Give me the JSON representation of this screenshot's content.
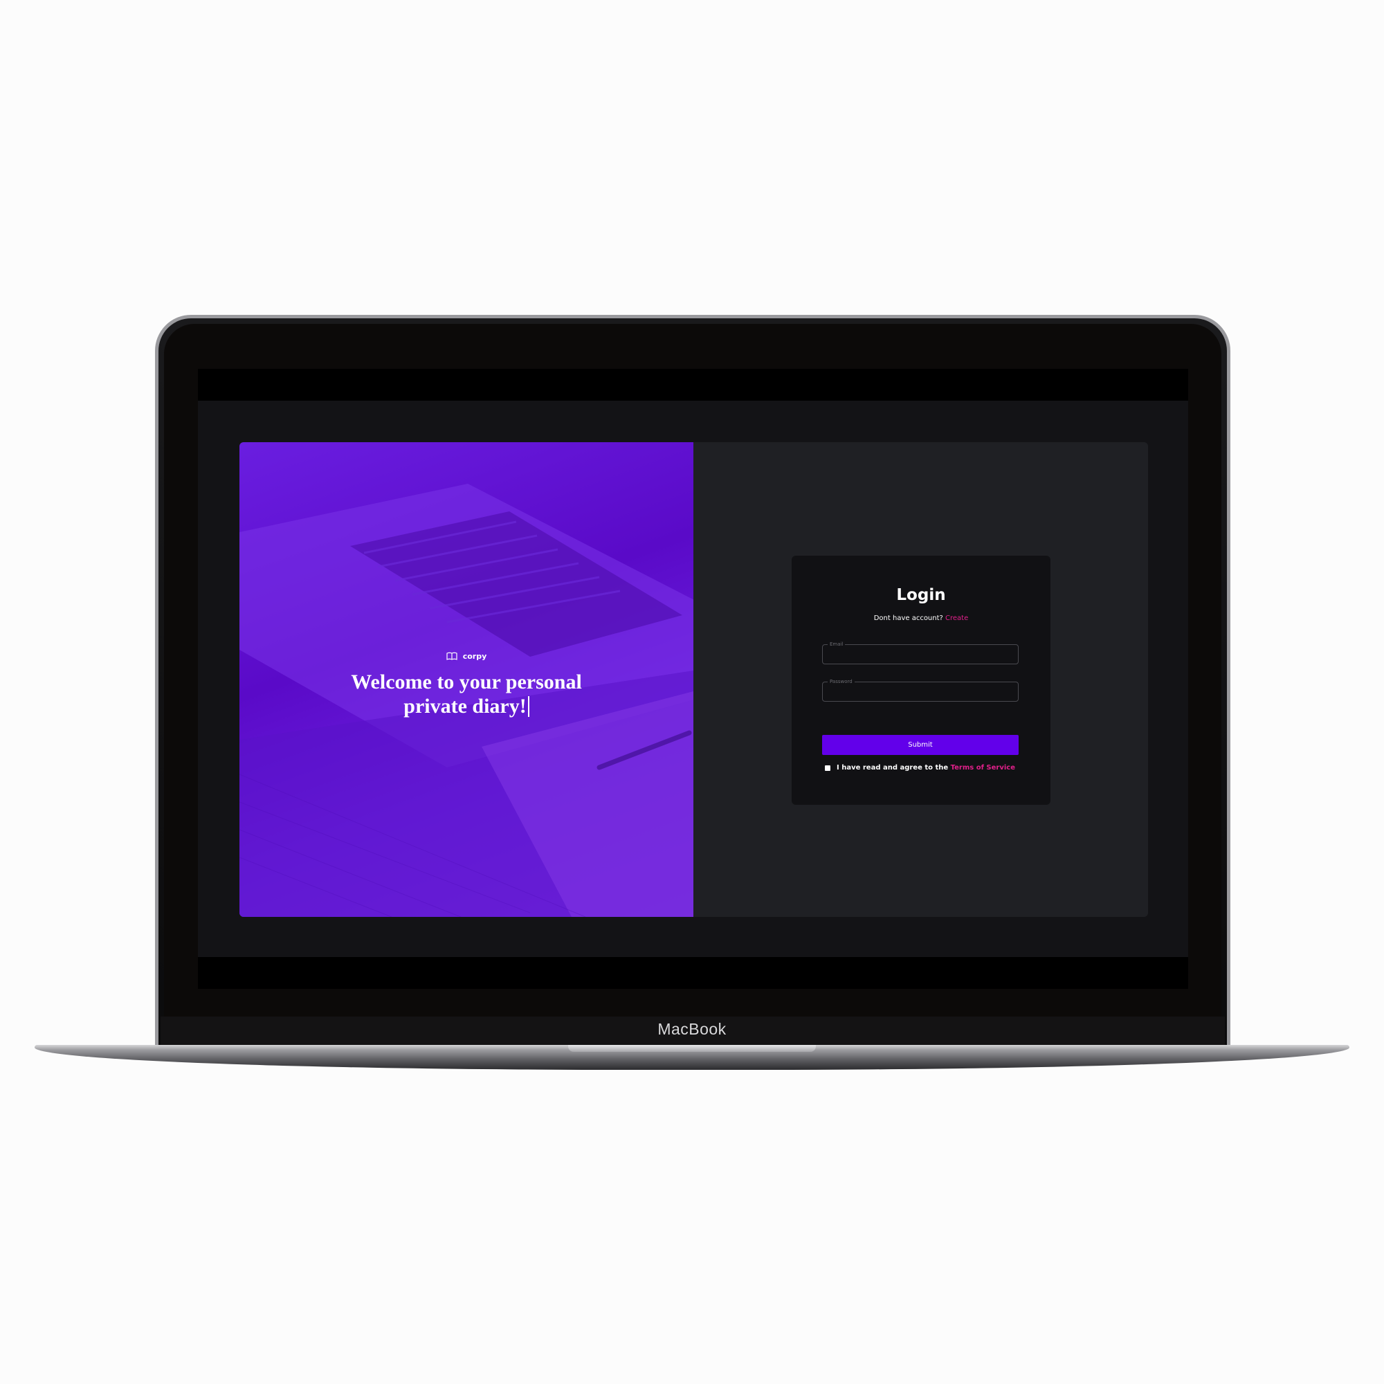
{
  "device": {
    "brand_label": "MacBook"
  },
  "hero": {
    "logo_text": "corpy",
    "logo_icon": "book-open-icon",
    "headline_line1": "Welcome to your personal",
    "headline_line2": "private diary!"
  },
  "login": {
    "title": "Login",
    "no_account_text": "Dont have account?",
    "create_link": "Create",
    "email_label": "Email",
    "email_value": "",
    "password_label": "Password",
    "password_value": "",
    "submit_label": "Submit",
    "agree_text": "I have read and agree to the",
    "terms_link": "Terms of Service"
  },
  "colors": {
    "accent": "#6200ea",
    "link": "#e0208a",
    "hero_purple": "#5a0ac8",
    "app_background": "#131316",
    "panel_background": "#1f2024",
    "card_background": "#111114"
  }
}
